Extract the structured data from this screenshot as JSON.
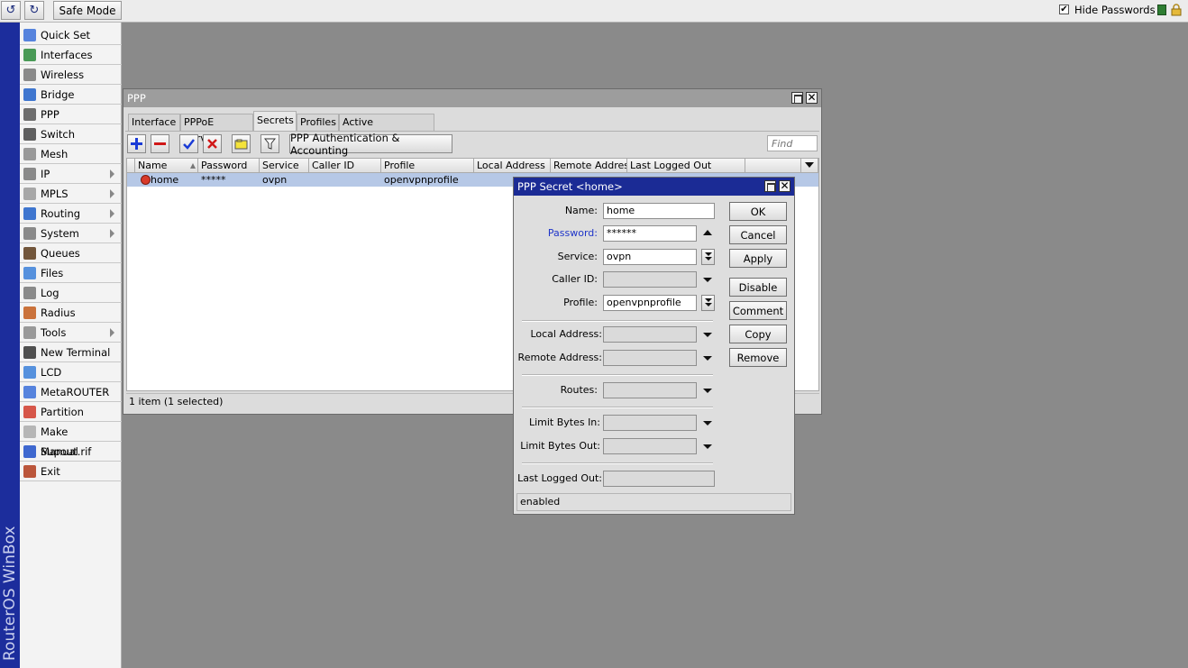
{
  "topbar": {
    "undo_icon": "undo-icon",
    "redo_icon": "redo-icon",
    "safe_mode_label": "Safe Mode",
    "hide_passwords_label": "Hide Passwords",
    "hide_passwords_checked": true
  },
  "banner": {
    "text": "RouterOS WinBox"
  },
  "sidebar": {
    "items": [
      {
        "label": "Quick Set",
        "icon": "quick-set-icon"
      },
      {
        "label": "Interfaces",
        "icon": "interfaces-icon"
      },
      {
        "label": "Wireless",
        "icon": "wireless-icon"
      },
      {
        "label": "Bridge",
        "icon": "bridge-icon"
      },
      {
        "label": "PPP",
        "icon": "ppp-icon"
      },
      {
        "label": "Switch",
        "icon": "switch-icon"
      },
      {
        "label": "Mesh",
        "icon": "mesh-icon"
      },
      {
        "label": "IP",
        "icon": "ip-icon",
        "submenu": true
      },
      {
        "label": "MPLS",
        "icon": "mpls-icon",
        "submenu": true
      },
      {
        "label": "Routing",
        "icon": "routing-icon",
        "submenu": true
      },
      {
        "label": "System",
        "icon": "system-icon",
        "submenu": true
      },
      {
        "label": "Queues",
        "icon": "queues-icon"
      },
      {
        "label": "Files",
        "icon": "files-icon"
      },
      {
        "label": "Log",
        "icon": "log-icon"
      },
      {
        "label": "Radius",
        "icon": "radius-icon"
      },
      {
        "label": "Tools",
        "icon": "tools-icon",
        "submenu": true
      },
      {
        "label": "New Terminal",
        "icon": "terminal-icon"
      },
      {
        "label": "LCD",
        "icon": "lcd-icon"
      },
      {
        "label": "MetaROUTER",
        "icon": "metarouter-icon"
      },
      {
        "label": "Partition",
        "icon": "partition-icon"
      },
      {
        "label": "Make Supout.rif",
        "icon": "supout-icon"
      },
      {
        "label": "Manual",
        "icon": "manual-icon"
      },
      {
        "label": "Exit",
        "icon": "exit-icon"
      }
    ]
  },
  "ppp_window": {
    "title": "PPP",
    "tabs": [
      "Interface",
      "PPPoE Servers",
      "Secrets",
      "Profiles",
      "Active Connections"
    ],
    "selected_tab": "Secrets",
    "auth_button_label": "PPP Authentication & Accounting",
    "find_placeholder": "Find",
    "columns": [
      "Name",
      "Password",
      "Service",
      "Caller ID",
      "Profile",
      "Local Address",
      "Remote Addres",
      "Last Logged Out"
    ],
    "rows": [
      {
        "name": "home",
        "password": "*****",
        "service": "ovpn",
        "caller_id": "",
        "profile": "openvpnprofile",
        "local_address": "",
        "remote_address": "",
        "last_logged_out": "",
        "selected": true
      }
    ],
    "status": "1 item (1 selected)"
  },
  "secret_dialog": {
    "title": "PPP Secret <home>",
    "fields": {
      "name_label": "Name:",
      "name_value": "home",
      "password_label": "Password:",
      "password_value": "******",
      "service_label": "Service:",
      "service_value": "ovpn",
      "caller_id_label": "Caller ID:",
      "caller_id_value": "",
      "profile_label": "Profile:",
      "profile_value": "openvpnprofile",
      "local_address_label": "Local Address:",
      "local_address_value": "",
      "remote_address_label": "Remote Address:",
      "remote_address_value": "",
      "routes_label": "Routes:",
      "routes_value": "",
      "limit_in_label": "Limit Bytes In:",
      "limit_in_value": "",
      "limit_out_label": "Limit Bytes Out:",
      "limit_out_value": "",
      "last_logged_out_label": "Last Logged Out:",
      "last_logged_out_value": ""
    },
    "buttons": {
      "ok": "OK",
      "cancel": "Cancel",
      "apply": "Apply",
      "disable": "Disable",
      "comment": "Comment",
      "copy": "Copy",
      "remove": "Remove"
    },
    "status": "enabled"
  },
  "colors": {
    "banner": "#1c2d9c",
    "active_title": "#1b2b95",
    "selected_row": "#b6c8e6",
    "link_label": "#1f35c9"
  }
}
